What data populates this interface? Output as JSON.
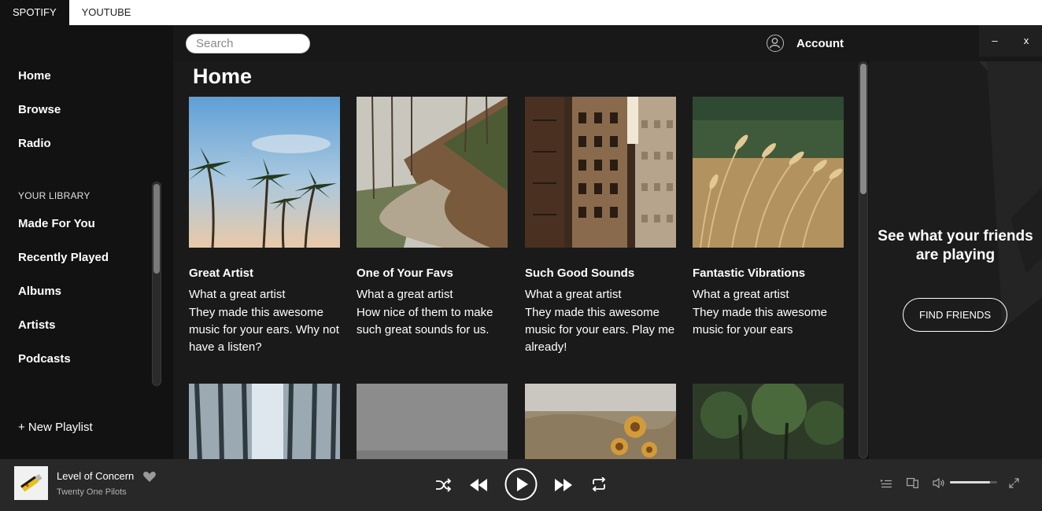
{
  "tabs": [
    {
      "label": "SPOTIFY",
      "active": true
    },
    {
      "label": "YOUTUBE",
      "active": false
    }
  ],
  "sidebar": {
    "nav": [
      {
        "label": "Home"
      },
      {
        "label": "Browse"
      },
      {
        "label": "Radio"
      }
    ],
    "library_heading": "YOUR LIBRARY",
    "library": [
      {
        "label": "Made For You"
      },
      {
        "label": "Recently Played"
      },
      {
        "label": "Albums"
      },
      {
        "label": "Artists"
      },
      {
        "label": "Podcasts"
      }
    ],
    "new_playlist": "+ New Playlist"
  },
  "header": {
    "search_placeholder": "Search",
    "account_label": "Account",
    "minimize": "–",
    "close": "x"
  },
  "main": {
    "title": "Home",
    "cards": [
      {
        "title": "Great Artist",
        "subtitle": "What a great artist",
        "description": "They made this awesome music for your ears. Why not have a listen?"
      },
      {
        "title": "One of Your Favs",
        "subtitle": "What a great artist",
        "description": "How nice of them to make such great sounds for us."
      },
      {
        "title": "Such Good Sounds",
        "subtitle": "What a great artist",
        "description": "They made this awesome music for your ears. Play me already!"
      },
      {
        "title": "Fantastic Vibrations",
        "subtitle": "What a great artist",
        "description": "They made this awesome music for your ears"
      }
    ]
  },
  "friends": {
    "text": "See what your friends are playing",
    "button": "FIND FRIENDS"
  },
  "player": {
    "track_title": "Level of Concern",
    "track_artist": "Twenty One Pilots",
    "volume": 0.85
  },
  "colors": {
    "background": "#121212",
    "panel": "#1a1a1a",
    "player": "#282828",
    "text": "#ffffff"
  }
}
